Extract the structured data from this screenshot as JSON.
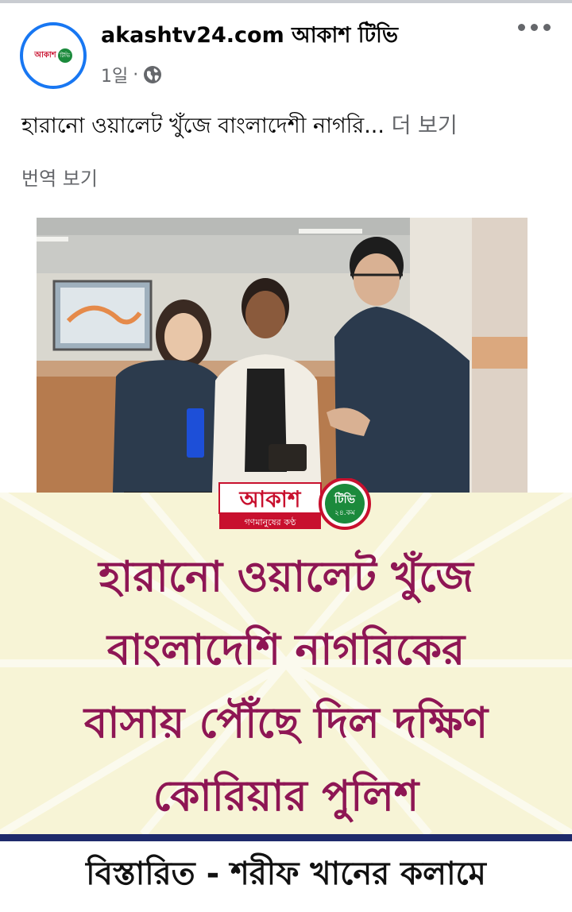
{
  "post": {
    "page_name": "akashtv24.com  আকাশ টিভি",
    "time": "1일",
    "separator": "·",
    "caption": "হারানো ওয়ালেট খুঁজে  বাংলাদেশী নাগরি...",
    "see_more": "더 보기",
    "translate": "번역 보기"
  },
  "avatar": {
    "text": "আকাশ",
    "badge": "টিভি"
  },
  "image": {
    "logo_main": "আকাশ",
    "logo_badge": "টিভি",
    "logo_badge_sub": "২৪.কম",
    "logo_tagline": "গণমানুষের কণ্ঠ",
    "headline": [
      "হারানো ওয়ালেট খুঁজে",
      "বাংলাদেশি নাগরিকের",
      "বাসায় পৌঁছে দিল দক্ষিণ",
      "কোরিয়ার পুলিশ"
    ],
    "footer": "বিস্তারিত - শরীফ খানের কলামে"
  },
  "colors": {
    "accent_blue": "#1877f2",
    "headline": "#8e1654",
    "banner_bg": "#f7f4d6",
    "rule": "#1e2a6b",
    "logo_red": "#c8102e",
    "logo_green": "#1b8a3c"
  },
  "icons": [
    "globe-icon",
    "more-options-icon"
  ]
}
